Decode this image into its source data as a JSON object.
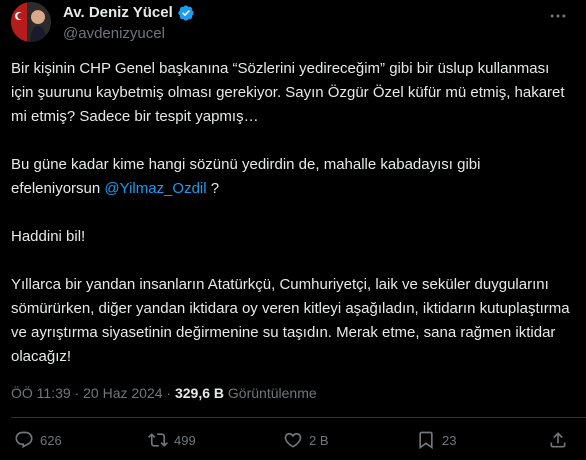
{
  "author": {
    "name": "Av. Deniz Yücel",
    "handle": "@avdenizyucel"
  },
  "tweet": {
    "p1": "Bir kişinin CHP Genel başkanına “Sözlerini yedireceğim” gibi bir üslup kullanması için şuurunu kaybetmiş olması gerekiyor. Sayın Özgür Özel küfür mü etmiş, hakaret mi etmiş? Sadece bir tespit yapmış…",
    "p2_text": "Bu güne kadar kime hangi sözünü yedirdin de, mahalle kabadayısı gibi efeleniyorsun ",
    "p2_mention": "@Yilmaz_Ozdil",
    "p2_suffix": " ?",
    "p3": "Haddini bil!",
    "p4": "Yıllarca bir yandan insanların Atatürkçü, Cumhuriyetçi, laik ve seküler duygularını sömürürken, diğer yandan iktidara oy veren kitleyi aşağıladın, iktidarın kutuplaştırma ve ayrıştırma siyasetinin değirmenine su taşıdın. Merak etme, sana rağmen iktidar olacağız!"
  },
  "meta": {
    "time": "ÖÖ 11:39",
    "separator": "·",
    "date": "20 Haz 2024",
    "views": "329,6 B",
    "views_label": "Görüntülenme"
  },
  "actions": {
    "replies": "626",
    "reposts": "499",
    "likes": "2 B",
    "bookmarks": "23"
  },
  "colors": {
    "background": "#000000",
    "text": "#e7e9ea",
    "muted": "#71767b",
    "accent": "#1d9bf0",
    "divider": "#2f3336"
  },
  "icons": [
    "verified-badge-icon",
    "more-icon",
    "reply-icon",
    "repost-icon",
    "like-icon",
    "bookmark-icon",
    "share-icon"
  ]
}
